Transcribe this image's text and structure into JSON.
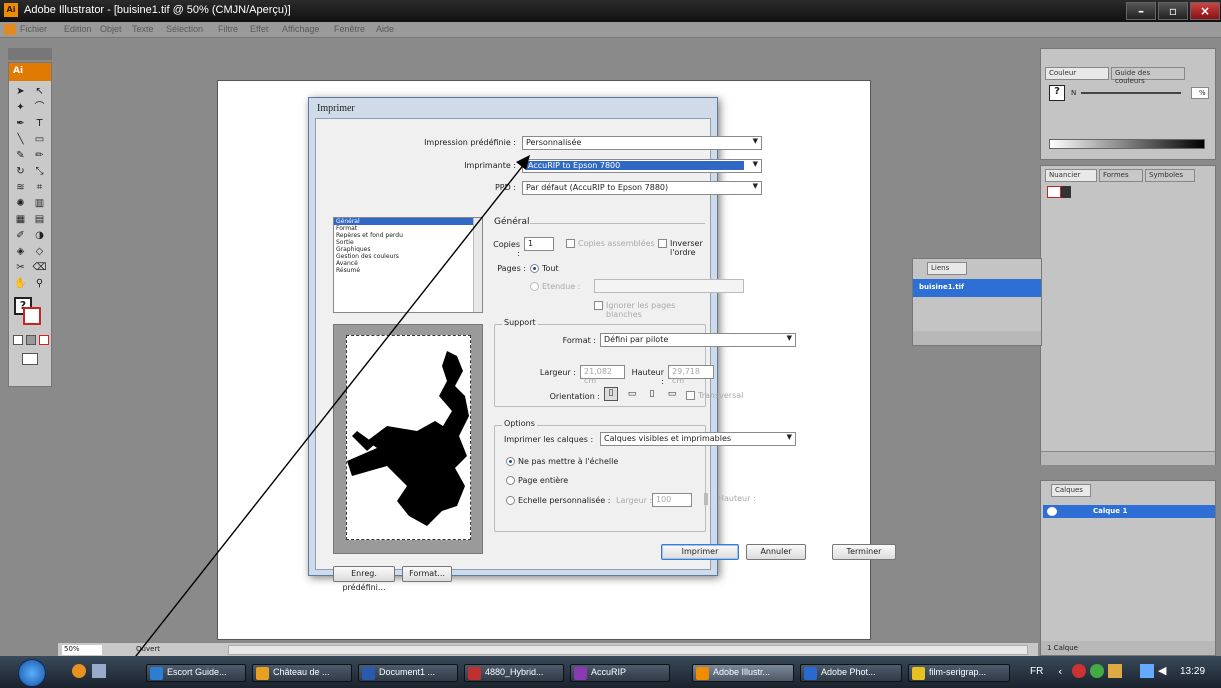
{
  "window": {
    "title": "Adobe Illustrator - [buisine1.tif @ 50% (CMJN/Aperçu)]",
    "app_icon": "Ai"
  },
  "menu": [
    "Fichier",
    "Edition",
    "Objet",
    "Texte",
    "Sélection",
    "Filtre",
    "Effet",
    "Affichage",
    "Fenêtre",
    "Aide"
  ],
  "toolbox": {
    "logo": "Ai"
  },
  "dialog": {
    "title": "Imprimer",
    "preset_label": "Impression prédéfinie :",
    "preset_value": "Personnalisée",
    "printer_label": "Imprimante :",
    "printer_value": "AccuRIP to Epson 7800",
    "ppd_label": "PPD :",
    "ppd_value": "Par défaut (AccuRIP to Epson 7880)",
    "categories": [
      "Général",
      "Format",
      "Repères et fond perdu",
      "Sortie",
      "Graphiques",
      "Gestion des couleurs",
      "Avancé",
      "Résumé"
    ],
    "section_title": "Général",
    "copies_label": "Copies :",
    "copies_value": "1",
    "collate_label": "Copies assemblées",
    "reverse_label": "Inverser l'ordre",
    "pages_label": "Pages :",
    "all_label": "Tout",
    "range_label": "Etendue :",
    "skip_blank_label": "Ignorer les pages blanches",
    "support_group": "Support",
    "format_label": "Format :",
    "format_value": "Défini par pilote",
    "width_label": "Largeur :",
    "width_value": "21,082 cm",
    "height_label": "Hauteur :",
    "height_value": "29,718 cm",
    "orientation_label": "Orientation :",
    "transverse_label": "Transversal",
    "options_group": "Options",
    "layers_label": "Imprimer les calques :",
    "layers_value": "Calques visibles et imprimables",
    "no_scale_label": "Ne pas mettre à l'échelle",
    "fit_label": "Page entière",
    "custom_scale_label": "Echelle personnalisée :",
    "scale_width_label": "Largeur :",
    "scale_width_value": "100",
    "scale_height_label": "Hauteur :",
    "scale_height_value": "100",
    "save_preset_btn": "Enreg. prédéfini...",
    "format_btn": "Format...",
    "print_btn": "Imprimer",
    "cancel_btn": "Annuler",
    "done_btn": "Terminer"
  },
  "panels": {
    "color_tab": "Couleur",
    "color_guide_tab": "Guide des couleurs",
    "color_pct": "%",
    "color_k": "N",
    "swatches_tab": "Nuancier",
    "shapes_tab": "Formes",
    "symbols_tab": "Symboles",
    "links_tab": "Liens",
    "link_item": "buisine1.tif",
    "layers_tab": "Calques",
    "layer_item": "Calque 1",
    "layers_count": "1 Calque"
  },
  "status": {
    "zoom": "50%",
    "state": "Ouvert"
  },
  "taskbar": {
    "buttons": [
      {
        "label": "Escort Guide...",
        "color": "#2a7fd4"
      },
      {
        "label": "Château de ...",
        "color": "#e8a020"
      },
      {
        "label": "Document1 ...",
        "color": "#2a5ab0"
      },
      {
        "label": "4880_Hybrid...",
        "color": "#c03030"
      },
      {
        "label": "AccuRIP",
        "color": "#8a3ab0"
      },
      {
        "label": "Adobe Illustr...",
        "color": "#f08c00"
      },
      {
        "label": "Adobe Phot...",
        "color": "#2a6ad0"
      },
      {
        "label": "film-serigrap...",
        "color": "#e8c020"
      }
    ],
    "lang": "FR",
    "time": "13:29"
  }
}
